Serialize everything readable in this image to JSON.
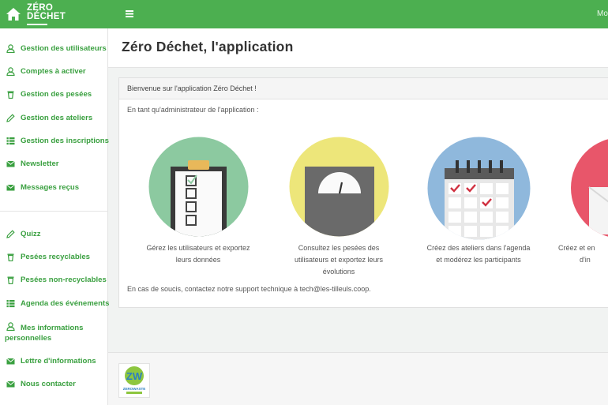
{
  "topbar": {
    "logo_line1": "ZÉRO",
    "logo_line2": "DÉCHET",
    "right_text": "Mo"
  },
  "sidebar": {
    "items": [
      {
        "label": "Gestion des utilisateurs",
        "icon": "user-icon"
      },
      {
        "label": "Comptes à activer",
        "icon": "user-icon"
      },
      {
        "label": "Gestion des pesées",
        "icon": "trash-icon"
      },
      {
        "label": "Gestion des ateliers",
        "icon": "pencil-icon"
      },
      {
        "label": "Gestion des inscriptions",
        "icon": "list-icon"
      },
      {
        "label": "Newsletter",
        "icon": "envelope-icon"
      },
      {
        "label": "Messages reçus",
        "icon": "envelope-icon"
      },
      {
        "label": "Quizz",
        "icon": "pencil-icon"
      },
      {
        "label": "Pesées recyclables",
        "icon": "trash-icon"
      },
      {
        "label": "Pesées non-recyclables",
        "icon": "trash-icon"
      },
      {
        "label": "Agenda des événements",
        "icon": "list-icon"
      },
      {
        "label": "Mes informations",
        "label_line2": "personnelles",
        "icon": "user-icon"
      },
      {
        "label": "Lettre d'informations",
        "icon": "envelope-icon"
      },
      {
        "label": "Nous contacter",
        "icon": "envelope-icon"
      }
    ]
  },
  "header": {
    "title": "Zéro Déchet, l'application"
  },
  "panel": {
    "heading": "Bienvenue sur l'application Zéro Déchet !",
    "intro": "En tant qu'administrateur de l'application :",
    "features": [
      {
        "icon": "checklist-icon",
        "line1": "Gérez les utilisateurs et exportez",
        "line2": "leurs données",
        "line3": ""
      },
      {
        "icon": "scale-icon",
        "line1": "Consultez les pesées des",
        "line2": "utilisateurs et exportez leurs",
        "line3": "évolutions"
      },
      {
        "icon": "calendar-icon",
        "line1": "Créez des ateliers dans l'agenda",
        "line2": "et modérez les participants",
        "line3": ""
      },
      {
        "icon": "envelope-icon",
        "line1": "Créez et en",
        "line2": "d'in",
        "line3": ""
      }
    ],
    "footer": "En cas de soucis, contactez notre support technique à tech@les-tilleuls.coop."
  },
  "footer_logo": {
    "text": "ZEROWASTE"
  },
  "colors": {
    "brand_green": "#4caf50",
    "nav_green": "#3aa040",
    "circle_green": "#8cc9a0",
    "circle_yellow": "#ede67a",
    "circle_blue": "#8fb8dc",
    "circle_red": "#e8566a"
  }
}
